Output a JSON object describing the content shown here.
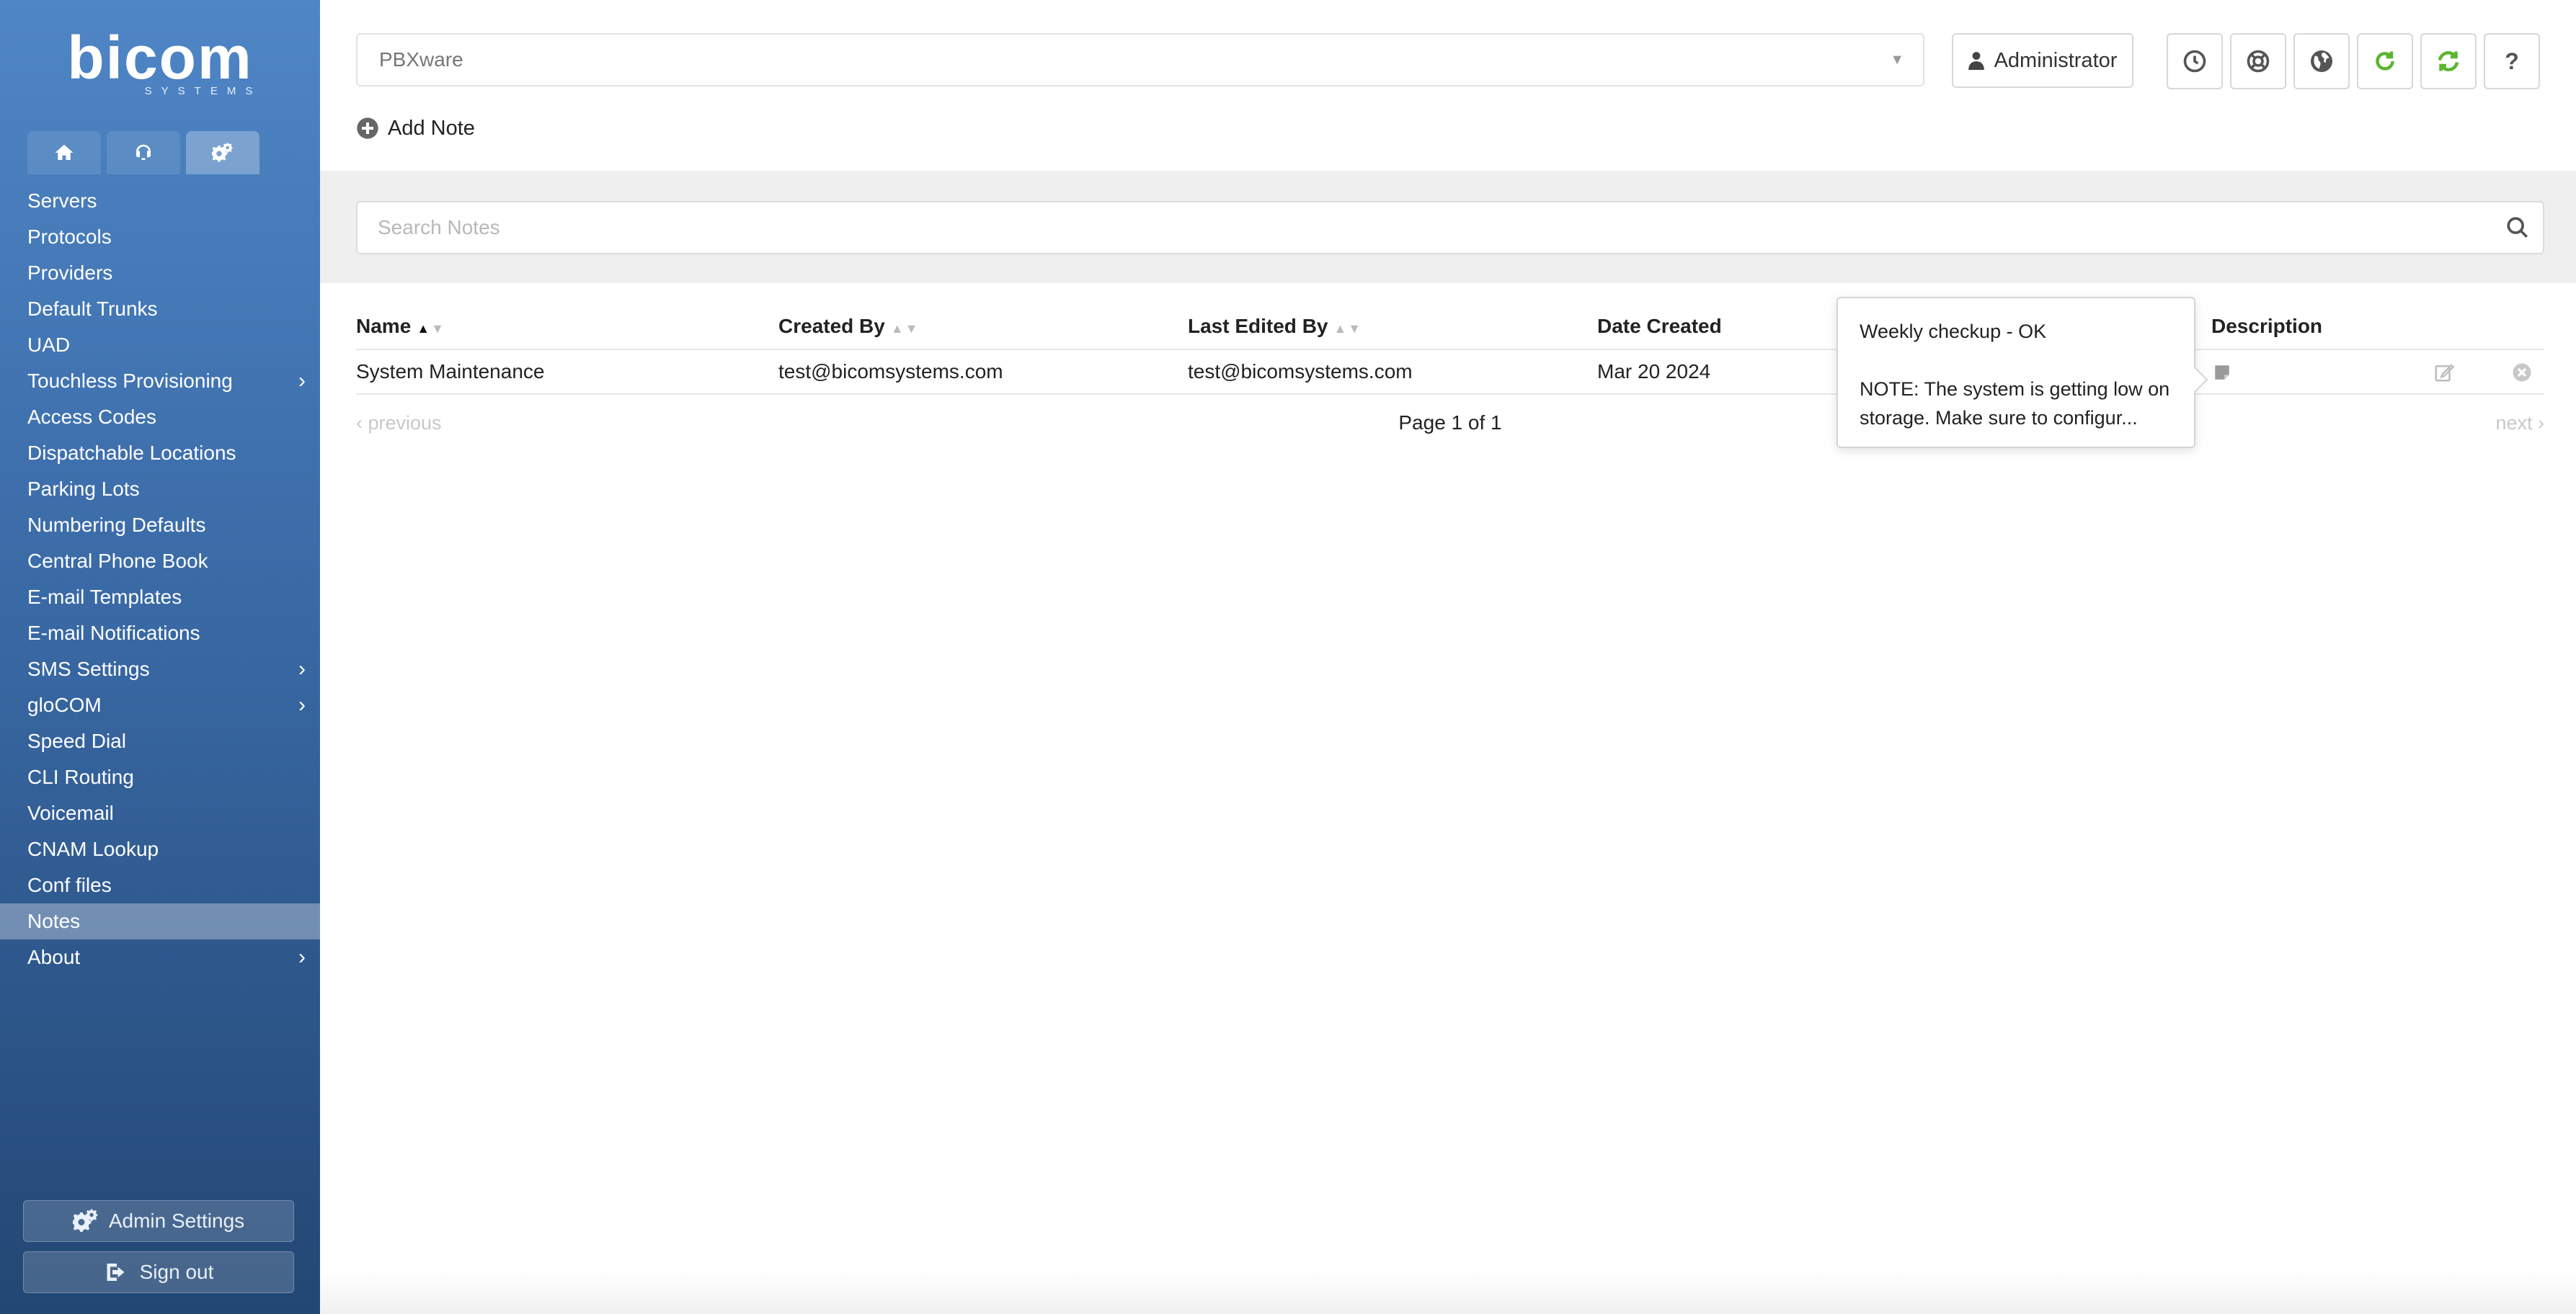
{
  "app": {
    "logo_text": "bicom",
    "logo_sub": "SYSTEMS"
  },
  "sidebar": {
    "tabs": [
      {
        "icon": "home-icon"
      },
      {
        "icon": "support-icon"
      },
      {
        "icon": "settings-gears-icon",
        "active": true
      }
    ],
    "items": [
      {
        "label": "Servers"
      },
      {
        "label": "Protocols"
      },
      {
        "label": "Providers"
      },
      {
        "label": "Default Trunks"
      },
      {
        "label": "UAD"
      },
      {
        "label": "Touchless Provisioning",
        "has_submenu": true
      },
      {
        "label": "Access Codes"
      },
      {
        "label": "Dispatchable Locations"
      },
      {
        "label": "Parking Lots"
      },
      {
        "label": "Numbering Defaults"
      },
      {
        "label": "Central Phone Book"
      },
      {
        "label": "E-mail Templates"
      },
      {
        "label": "E-mail Notifications"
      },
      {
        "label": "SMS Settings",
        "has_submenu": true
      },
      {
        "label": "gloCOM",
        "has_submenu": true
      },
      {
        "label": "Speed Dial"
      },
      {
        "label": "CLI Routing"
      },
      {
        "label": "Voicemail"
      },
      {
        "label": "CNAM Lookup"
      },
      {
        "label": "Conf files"
      },
      {
        "label": "Notes",
        "active": true
      },
      {
        "label": "About",
        "has_submenu": true
      }
    ],
    "admin_settings_label": "Admin Settings",
    "sign_out_label": "Sign out"
  },
  "header": {
    "server_select_value": "PBXware",
    "user_label": "Administrator",
    "toolbar_icons": [
      "clock-icon",
      "lifebuoy-icon",
      "globe-icon",
      "reload-icon",
      "sync-icon",
      "help-icon"
    ],
    "help_glyph": "?",
    "add_note_label": "Add Note"
  },
  "search": {
    "placeholder": "Search Notes",
    "value": ""
  },
  "table": {
    "columns": [
      "Name",
      "Created By",
      "Last Edited By",
      "Date Created",
      "Description"
    ],
    "rows": [
      {
        "name": "System Maintenance",
        "created_by": "test@bicomsystems.com",
        "last_edited_by": "test@bicomsystems.com",
        "date_created": "Mar 20 2024"
      }
    ],
    "pager": {
      "previous": "previous",
      "page_text": "Page 1 of 1",
      "next": "next"
    }
  },
  "tooltip": {
    "line1": "Weekly checkup - OK",
    "line2": "NOTE: The system is getting low on storage. Make sure to configur..."
  },
  "colors": {
    "sidebar_top": "#4f86c6",
    "sidebar_bottom": "#234774",
    "accent_green": "#5cb531",
    "search_band": "#efefef"
  }
}
